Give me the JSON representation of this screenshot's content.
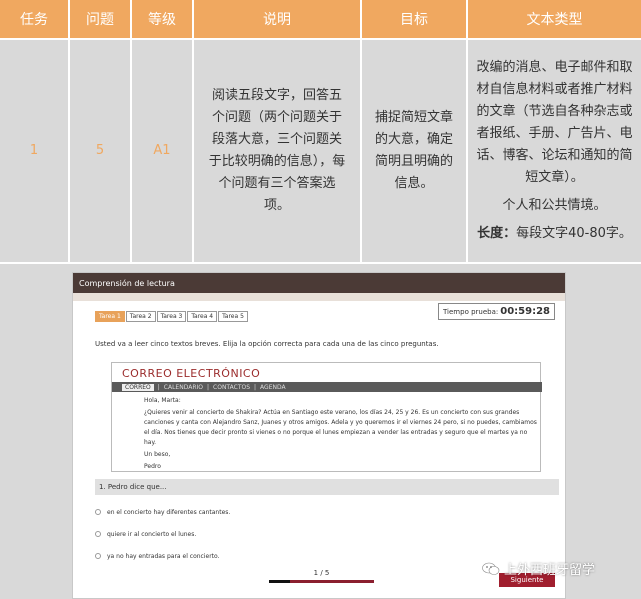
{
  "table": {
    "headers": [
      "任务",
      "问题",
      "等级",
      "说明",
      "目标",
      "文本类型"
    ],
    "row": {
      "task": "1",
      "questions": "5",
      "level": "A1",
      "description": "阅读五段文字，回答五个问题（两个问题关于段落大意，三个问题关于比较明确的信息），每个问题有三个答案选项。",
      "goal": "捕捉简短文章的大意，确定简明且明确的信息。",
      "text_type_para1": "改编的消息、电子邮件和取材自信息材料或者推广材料的文章（节选自各种杂志或者报纸、手册、广告片、电话、博客、论坛和通知的简短文章）。",
      "text_type_para2": "个人和公共情境。",
      "length_label": "长度：",
      "length_value": "每段文字40-80字。"
    },
    "colors": {
      "header_bg": "#f0a860",
      "cell_bg": "#d9d9d9",
      "accent_text": "#f0a860"
    }
  },
  "screenshot": {
    "window_title": "Comprensión de lectura",
    "tabs": [
      "Tarea 1",
      "Tarea 2",
      "Tarea 3",
      "Tarea 4",
      "Tarea 5"
    ],
    "active_tab": "Tarea 1",
    "timer_label": "Tiempo prueba:",
    "timer_value": "00:59:28",
    "instructions": "Usted va a leer cinco textos breves. Elija la opción correcta para cada una de las cinco preguntas.",
    "email": {
      "title": "CORREO ELECTRÓNICO",
      "nav": [
        "CORREO",
        "CALENDARIO",
        "CONTACTOS",
        "AGENDA"
      ],
      "greeting": "Hola, Marta:",
      "body": "¿Quieres venir al concierto de Shakira? Actúa en Santiago este verano, los días 24, 25 y 26. Es un concierto con sus grandes canciones y canta con Alejandro Sanz, Juanes y otros amigos. Adela y yo queremos ir el viernes 24 pero, si no puedes, cambiamos el día. Nos tienes que decir pronto si vienes o no porque el lunes empiezan a vender las entradas y seguro que el martes ya no hay.",
      "closing": "Un beso,",
      "signature": "Pedro"
    },
    "question": "1. Pedro dice que...",
    "options": [
      "en el concierto hay diferentes cantantes.",
      "quiere ir al concierto el lunes.",
      "ya no hay entradas para el concierto."
    ],
    "pager": "1 / 5",
    "progress_fraction": 0.2,
    "next_label": "Siguiente",
    "colors": {
      "topbar": "#4b3a36",
      "accent": "#a01e2e",
      "tab_active": "#e8a25a"
    }
  },
  "watermark": {
    "text": "上外西班牙留学",
    "icon": "wechat-icon"
  }
}
